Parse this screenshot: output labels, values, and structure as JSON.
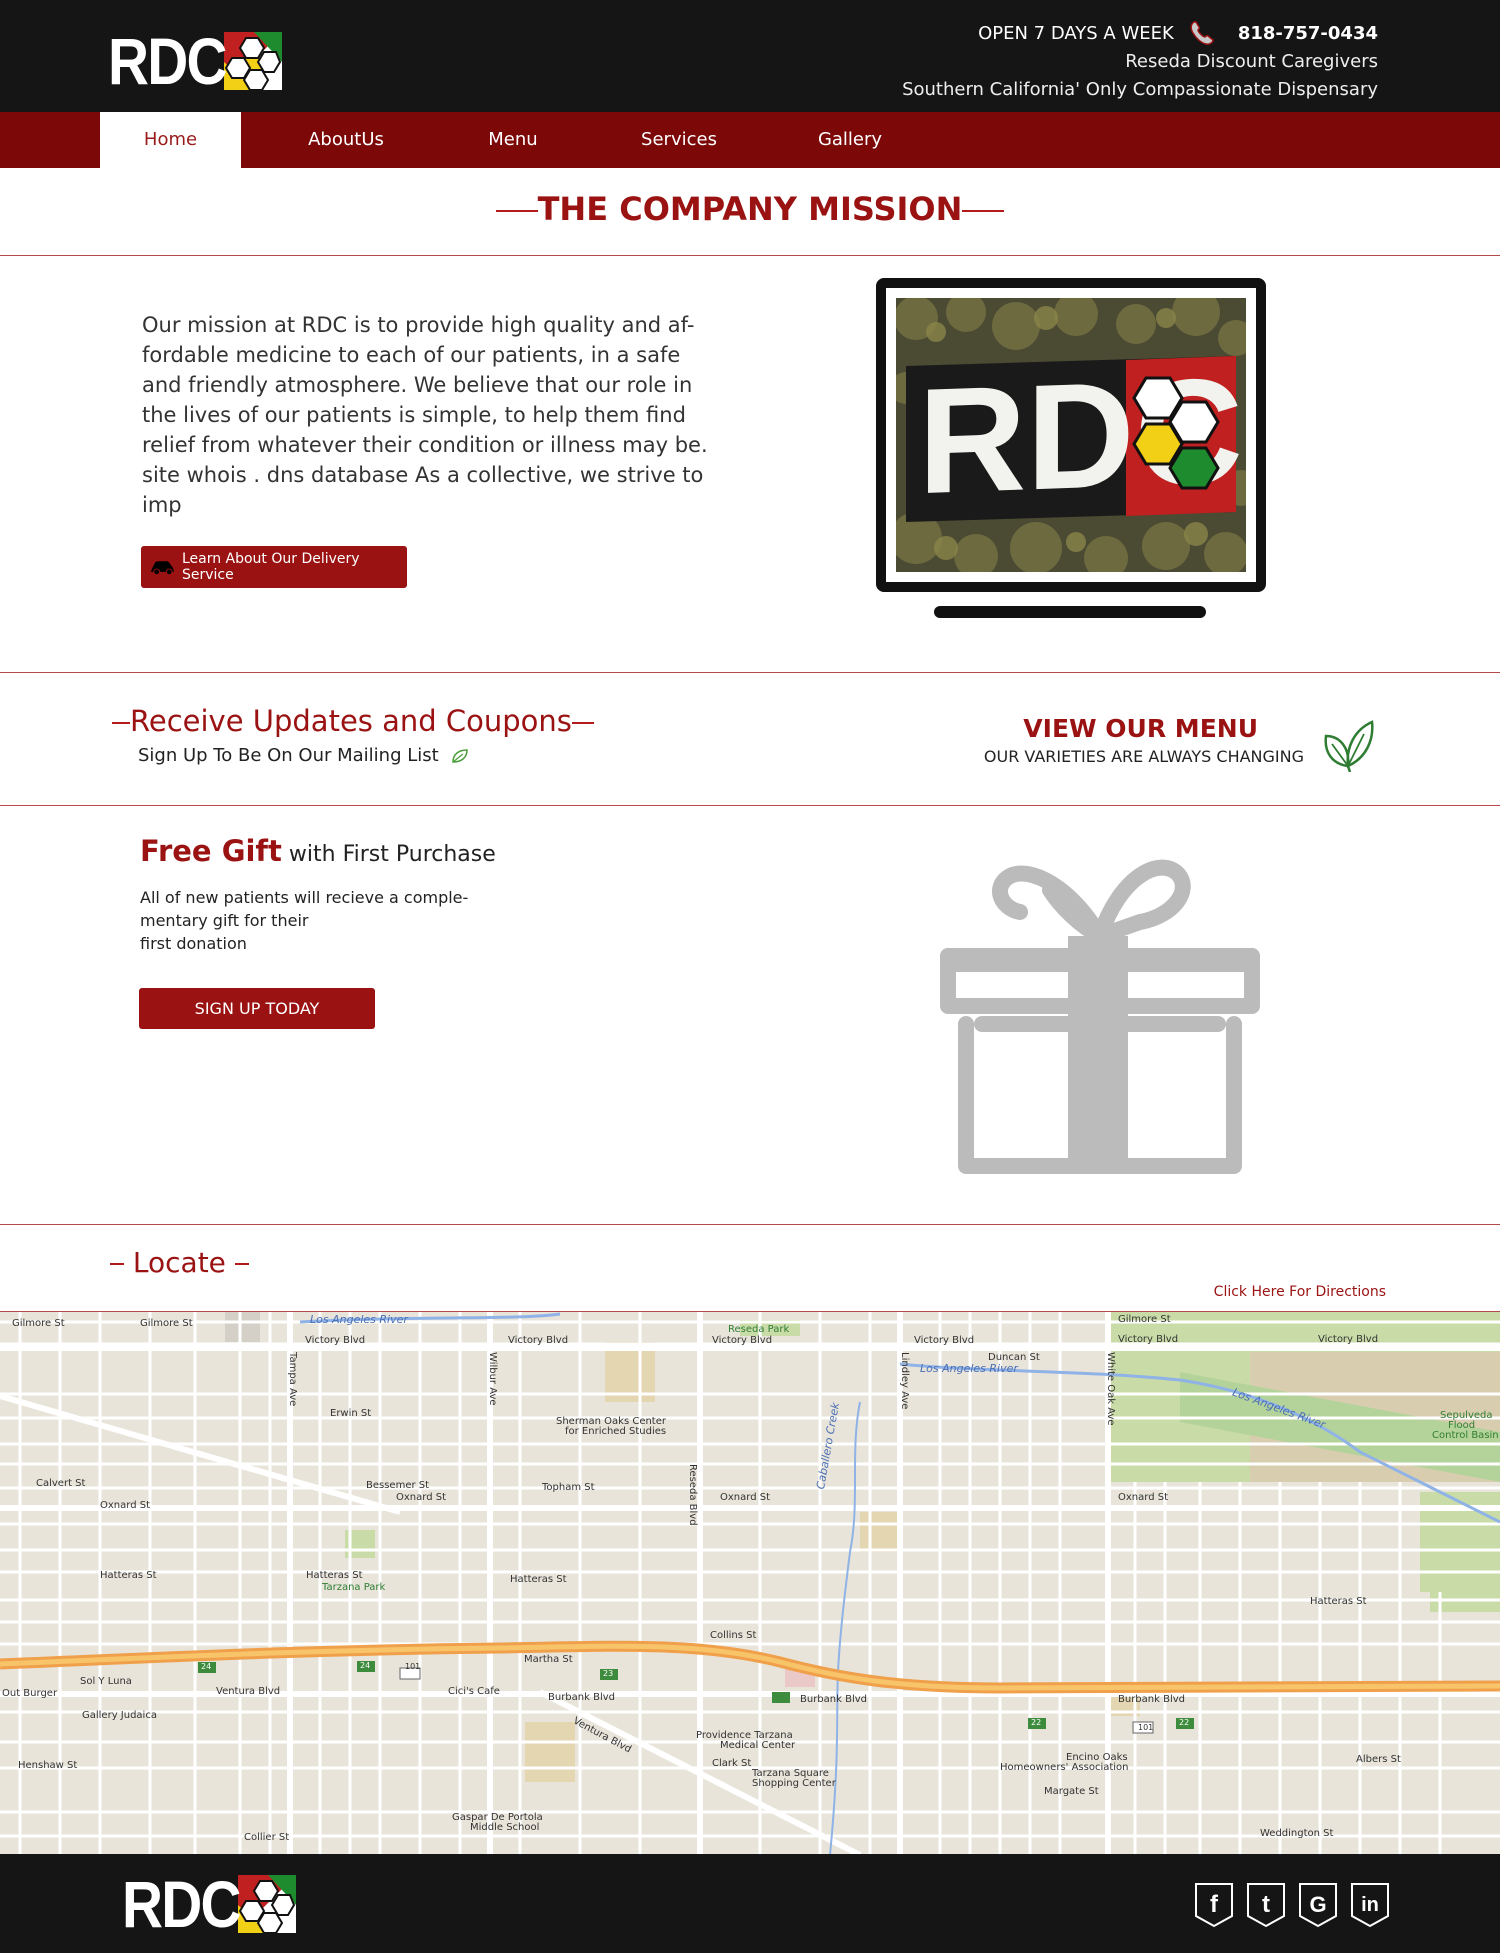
{
  "header": {
    "logo_text": "RDC",
    "open_text": "OPEN 7 DAYS A WEEK",
    "phone": "818-757-0434",
    "tagline1": "Reseda Discount Caregivers",
    "tagline2": "Southern California' Only Compassionate Dispensary"
  },
  "nav": {
    "items": [
      {
        "label": "Home",
        "active": true
      },
      {
        "label": "AboutUs"
      },
      {
        "label": "Menu"
      },
      {
        "label": "Services"
      },
      {
        "label": "Gallery"
      }
    ]
  },
  "mission": {
    "title": "THE COMPANY MISSION",
    "text": "Our mission at RDC is to provide high quality and af-fordable medicine to each of our patients, in a safe and friendly atmosphere. We believe that our role in the lives of our patients is simple, to help them find relief from whatever their condition or illness may be. site whois . dns database As a collective, we strive to imp",
    "button": "Learn About Our Delivery Service",
    "image_text": "RDC"
  },
  "updates": {
    "title": "Receive Updates and Coupons",
    "subtitle": "Sign Up To Be On Our Mailing List",
    "menu_title": "VIEW OUR MENU",
    "menu_subtitle": "OUR VARIETIES ARE ALWAYS CHANGING"
  },
  "gift": {
    "title_big": "Free Gift",
    "title_rest": " with First Purchase",
    "desc_line1": "All of new patients will recieve a comple-",
    "desc_line2": "mentary gift for their",
    "desc_line3": "first donation",
    "button": "SIGN UP TODAY"
  },
  "locate": {
    "title": "Locate",
    "directions": "Click Here For Directions"
  },
  "map": {
    "labels": {
      "gilmore_l": "Gilmore St",
      "gilmore_m": "Gilmore St",
      "gilmore_r": "Gilmore St",
      "victory_1": "Victory Blvd",
      "victory_2": "Victory Blvd",
      "victory_3": "Victory Blvd",
      "victory_4": "Victory Blvd",
      "victory_5": "Victory Blvd",
      "victory_6": "Victory Blvd",
      "la_river_1": "Los Angeles River",
      "la_river_2": "Los Angeles River",
      "la_river_3": "Los Angeles River",
      "reseda_park": "Reseda Park",
      "sherman_oaks": "Sherman Oaks Center",
      "enriched": "for Enriched Studies",
      "sepulveda": "Sepulveda",
      "flood": "Flood",
      "control": "Control Basin",
      "oxnard_1": "Oxnard St",
      "oxnard_2": "Oxnard St",
      "oxnard_3": "Oxnard St",
      "oxnard_4": "Oxnard St",
      "hatteras_1": "Hatteras St",
      "hatteras_2": "Hatteras St",
      "hatteras_3": "Hatteras St",
      "hatteras_4": "Hatteras St",
      "tarzana_park": "Tarzana Park",
      "caballero": "Caballero Creek",
      "ventura_1": "Ventura Blvd",
      "ventura_2": "Ventura Blvd",
      "burbank_1": "Burbank Blvd",
      "burbank_2": "Burbank Blvd",
      "burbank_3": "Burbank Blvd",
      "providence": "Providence Tarzana",
      "medical": "Medical Center",
      "tarzana_sq": "Tarzana Square",
      "shopping": "Shopping Center",
      "encino_oaks": "Encino Oaks",
      "homeowners": "Homeowners' Association",
      "gaspar": "Gaspar De Portola",
      "middle": "Middle School",
      "cicis": "Cici's Cafe",
      "gallery_judaica": "Gallery Judaica",
      "sol_luna": "Sol Y Luna",
      "out_burger": "Out Burger",
      "weddington": "Weddington St",
      "collier": "Collier St",
      "henshaw": "Henshaw St",
      "martha": "Martha St",
      "collins": "Collins St",
      "erwin": "Erwin St",
      "calvert": "Calvert St",
      "topham": "Topham St",
      "bessemer": "Bessemer St",
      "clark": "Clark St",
      "margate": "Margate St",
      "albers": "Albers St",
      "duncan": "Duncan St",
      "reseda_blvd": "Reseda Blvd",
      "lindley": "Lindley Ave",
      "white_oak": "White Oak Ave",
      "tampa": "Tampa Ave",
      "wilbur": "Wilbur Ave",
      "rt_101": "101",
      "rt_23": "23",
      "rt_24": "24",
      "rt_22": "22"
    }
  },
  "footer": {
    "logo_text": "RDC",
    "social": [
      "facebook",
      "twitter",
      "google",
      "linkedin"
    ]
  },
  "colors": {
    "header_bg": "#151515",
    "nav_bg": "#7d0808",
    "accent": "#9a1212",
    "gift_gray": "#bbbbbb"
  }
}
